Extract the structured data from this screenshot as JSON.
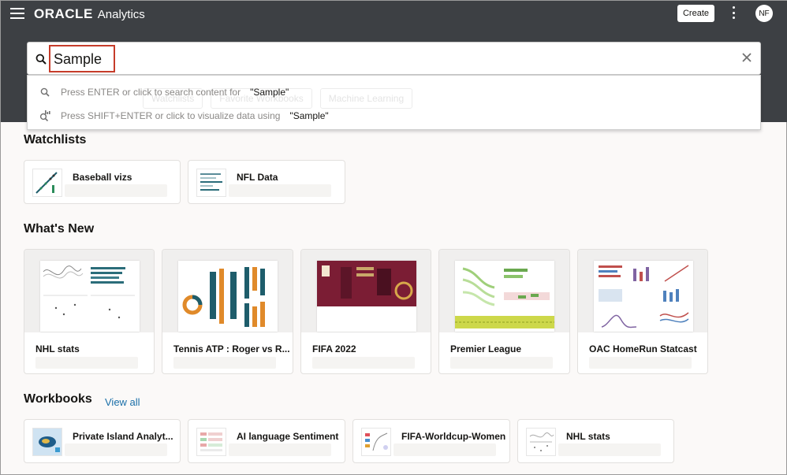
{
  "header": {
    "brand_logo": "ORACLE",
    "brand_product": "Analytics",
    "create_label": "Create",
    "avatar_initials": "NF"
  },
  "search": {
    "value": "Sample",
    "ghost_chips": [
      "Watchlists",
      "Favorite Workbooks",
      "Machine Learning"
    ],
    "suggestions": [
      {
        "text": "Press ENTER or click to search content for",
        "query": "\"Sample\"",
        "icon": "search-icon"
      },
      {
        "text": "Press SHIFT+ENTER or click to visualize data using",
        "query": "\"Sample\"",
        "icon": "visualize-search-icon"
      }
    ]
  },
  "sections": {
    "watchlists": "Watchlists",
    "whats_new": "What's New",
    "workbooks": "Workbooks",
    "view_all": "View all"
  },
  "watchlists": [
    {
      "title": "Baseball vizs"
    },
    {
      "title": "NFL Data"
    }
  ],
  "whats_new": [
    {
      "title": "NHL stats"
    },
    {
      "title": "Tennis ATP : Roger vs R..."
    },
    {
      "title": "FIFA 2022"
    },
    {
      "title": "Premier League"
    },
    {
      "title": "OAC HomeRun Statcast"
    }
  ],
  "workbooks": [
    {
      "title": "Private Island Analyt..."
    },
    {
      "title": "AI language Sentiment"
    },
    {
      "title": "FIFA-Worldcup-Women"
    },
    {
      "title": "NHL stats"
    }
  ]
}
